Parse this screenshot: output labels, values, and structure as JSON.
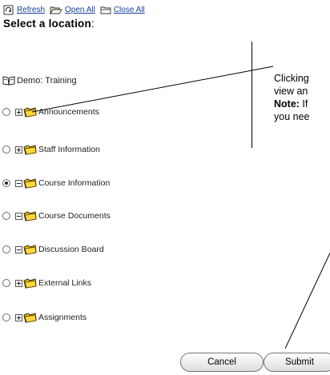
{
  "toolbar": {
    "refresh_label": "Refresh",
    "open_all_label": "Open All",
    "close_all_label": "Close All"
  },
  "heading": {
    "text": "Select a location",
    "colon": ":"
  },
  "root": {
    "label": "Demo: Training",
    "icon": "book-icon"
  },
  "tree": {
    "items": [
      {
        "label": "Announcements",
        "expander": "plus",
        "selected": false
      },
      {
        "label": "Staff Information",
        "expander": "plus",
        "selected": false
      },
      {
        "label": "Course Information",
        "expander": "minus",
        "selected": true
      },
      {
        "label": "Course Documents",
        "expander": "minus",
        "selected": false
      },
      {
        "label": "Discussion Board",
        "expander": "minus",
        "selected": false
      },
      {
        "label": "External Links",
        "expander": "plus",
        "selected": false
      },
      {
        "label": "Assignments",
        "expander": "plus",
        "selected": false
      }
    ]
  },
  "callout": {
    "line1": "Clicking",
    "line2": "view an",
    "note_label": "Note:",
    "line3_rest": " If",
    "line4": "you nee"
  },
  "buttons": {
    "cancel_label": "Cancel",
    "submit_label": "Submit"
  },
  "colors": {
    "link": "#1a3f9c",
    "folder_yellow": "#f5c400",
    "folder_outline": "#3a2a00"
  }
}
